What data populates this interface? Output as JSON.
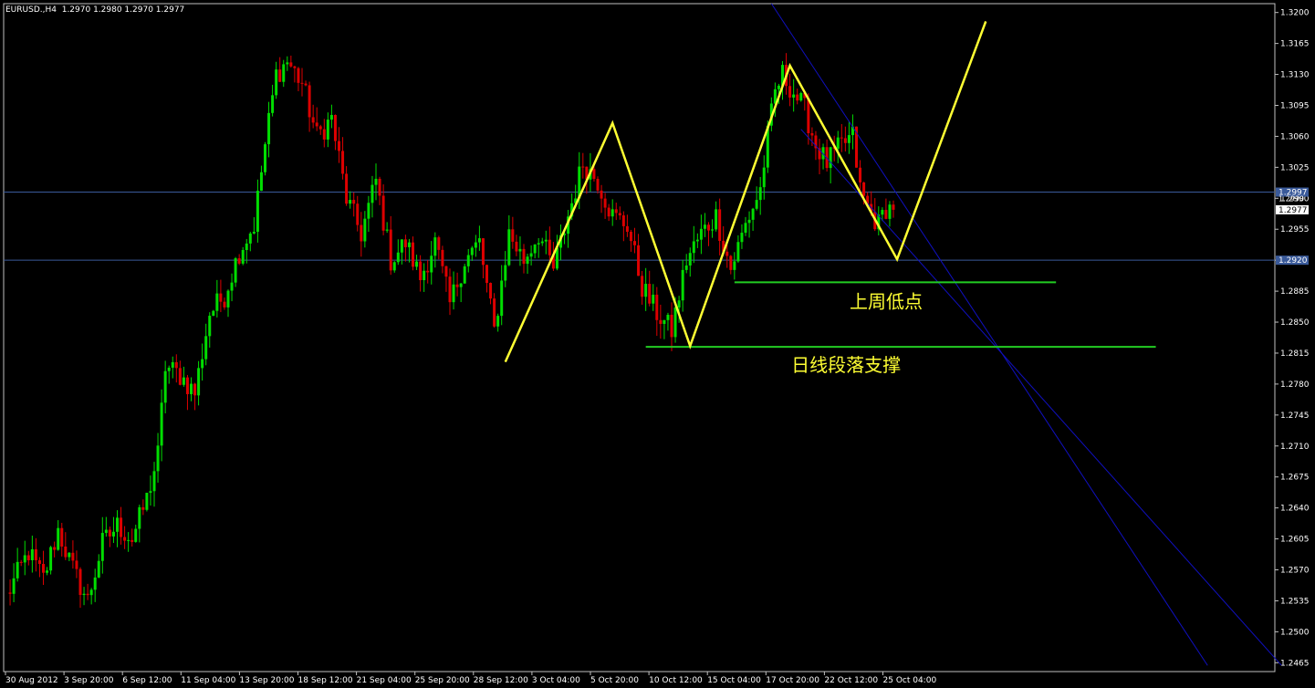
{
  "header": {
    "symbol": "EURUSD.,H4",
    "ohlc": "1.2970 1.2980 1.2970 1.2977"
  },
  "colors": {
    "background": "#000000",
    "frame": "#c0c0c0",
    "bull": "#00dd00",
    "bear": "#dd0000",
    "zigzag": "#ffff33",
    "support": "#22cc22",
    "channel": "#1010c0",
    "level_line": "#3a5a9a",
    "label_text": "#ffff33"
  },
  "chart_data": {
    "type": "candlestick",
    "title": "EURUSD.,H4",
    "ylim": [
      1.2455,
      1.321
    ],
    "y_ticks": [
      "1.3200",
      "1.3165",
      "1.3130",
      "1.3095",
      "1.3060",
      "1.3025",
      "1.2990",
      "1.2955",
      "1.2920",
      "1.2885",
      "1.2850",
      "1.2815",
      "1.2780",
      "1.2745",
      "1.2710",
      "1.2675",
      "1.2640",
      "1.2605",
      "1.2570",
      "1.2535",
      "1.2500",
      "1.2465"
    ],
    "x_labels": [
      "30 Aug 2012",
      "3 Sep 20:00",
      "6 Sep 12:00",
      "11 Sep 04:00",
      "13 Sep 20:00",
      "18 Sep 12:00",
      "21 Sep 04:00",
      "25 Sep 20:00",
      "28 Sep 12:00",
      "3 Oct 04:00",
      "5 Oct 20:00",
      "10 Oct 12:00",
      "15 Oct 04:00",
      "17 Oct 20:00",
      "22 Oct 12:00",
      "25 Oct 04:00"
    ],
    "bars_total": 240,
    "price_path": [
      [
        0,
        1.254
      ],
      [
        6,
        1.259
      ],
      [
        10,
        1.256
      ],
      [
        14,
        1.2615
      ],
      [
        18,
        1.257
      ],
      [
        22,
        1.2535
      ],
      [
        26,
        1.26
      ],
      [
        30,
        1.262
      ],
      [
        34,
        1.2605
      ],
      [
        38,
        1.265
      ],
      [
        41,
        1.27
      ],
      [
        43,
        1.28
      ],
      [
        47,
        1.279
      ],
      [
        51,
        1.277
      ],
      [
        55,
        1.286
      ],
      [
        59,
        1.288
      ],
      [
        63,
        1.293
      ],
      [
        67,
        1.296
      ],
      [
        70,
        1.305
      ],
      [
        73,
        1.313
      ],
      [
        76,
        1.3145
      ],
      [
        80,
        1.312
      ],
      [
        84,
        1.306
      ],
      [
        88,
        1.308
      ],
      [
        92,
        1.299
      ],
      [
        96,
        1.295
      ],
      [
        100,
        1.301
      ],
      [
        104,
        1.292
      ],
      [
        108,
        1.294
      ],
      [
        112,
        1.29
      ],
      [
        116,
        1.294
      ],
      [
        120,
        1.287
      ],
      [
        124,
        1.292
      ],
      [
        128,
        1.294
      ],
      [
        132,
        1.284
      ],
      [
        136,
        1.295
      ],
      [
        140,
        1.292
      ],
      [
        144,
        1.295
      ],
      [
        148,
        1.291
      ],
      [
        152,
        1.297
      ],
      [
        156,
        1.303
      ],
      [
        160,
        1.301
      ],
      [
        164,
        1.297
      ],
      [
        168,
        1.296
      ],
      [
        172,
        1.289
      ],
      [
        176,
        1.286
      ],
      [
        180,
        1.284
      ],
      [
        184,
        1.292
      ],
      [
        188,
        1.295
      ],
      [
        192,
        1.297
      ],
      [
        196,
        1.291
      ],
      [
        200,
        1.296
      ],
      [
        204,
        1.3
      ],
      [
        206,
        1.306
      ],
      [
        208,
        1.311
      ],
      [
        210,
        1.313
      ],
      [
        213,
        1.311
      ],
      [
        216,
        1.309
      ],
      [
        219,
        1.305
      ],
      [
        222,
        1.303
      ],
      [
        226,
        1.305
      ],
      [
        229,
        1.306
      ],
      [
        231,
        1.3
      ],
      [
        233,
        1.298
      ],
      [
        236,
        1.296
      ],
      [
        238,
        1.298
      ],
      [
        240,
        1.2977
      ]
    ],
    "levels": [
      {
        "price": 1.2997,
        "label": "1.2997"
      },
      {
        "price": 1.292,
        "label": "1.2920"
      }
    ],
    "current_price_label": "1.2977",
    "current_price_label_2": "1.2990",
    "zigzag": [
      {
        "x": 135,
        "y": 1.2805
      },
      {
        "x": 164,
        "y": 1.3075
      },
      {
        "x": 185,
        "y": 1.2823
      },
      {
        "x": 212,
        "y": 1.314
      },
      {
        "x": 241,
        "y": 1.2921
      },
      {
        "x": 265,
        "y": 1.319
      }
    ],
    "support_lines": [
      {
        "y": 1.2895,
        "x0": 197,
        "x1": 284,
        "label": "上周低点"
      },
      {
        "y": 1.2822,
        "x0": 173,
        "x1": 311,
        "label": "日线段落支撑"
      }
    ],
    "channel_lines": [
      {
        "x0": 207,
        "y0": 1.321,
        "x1": 325,
        "y1": 1.2462
      },
      {
        "x0": 215,
        "y0": 1.3068,
        "x1": 345,
        "y1": 1.2462
      }
    ]
  }
}
